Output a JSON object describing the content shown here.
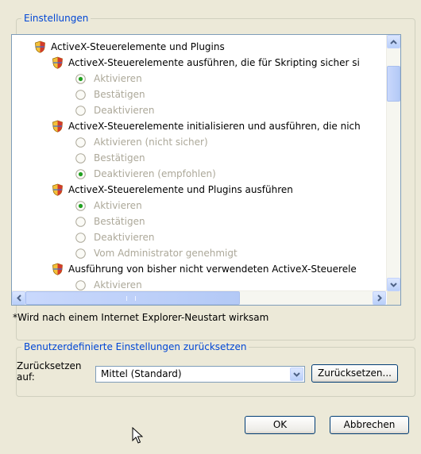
{
  "settings_group": {
    "title": "Einstellungen",
    "items": [
      {
        "kind": "category",
        "label": "ActiveX-Steuerelemente und Plugins"
      },
      {
        "kind": "setting",
        "label": "ActiveX-Steuerelemente ausführen, die für Skripting sicher si"
      },
      {
        "kind": "option",
        "label": "Aktivieren",
        "selected": true
      },
      {
        "kind": "option",
        "label": "Bestätigen",
        "selected": false
      },
      {
        "kind": "option",
        "label": "Deaktivieren",
        "selected": false
      },
      {
        "kind": "setting",
        "label": "ActiveX-Steuerelemente initialisieren und ausführen, die nich"
      },
      {
        "kind": "option",
        "label": "Aktivieren (nicht sicher)",
        "selected": false
      },
      {
        "kind": "option",
        "label": "Bestätigen",
        "selected": false
      },
      {
        "kind": "option",
        "label": "Deaktivieren (empfohlen)",
        "selected": true
      },
      {
        "kind": "setting",
        "label": "ActiveX-Steuerelemente und Plugins ausführen"
      },
      {
        "kind": "option",
        "label": "Aktivieren",
        "selected": true
      },
      {
        "kind": "option",
        "label": "Bestätigen",
        "selected": false
      },
      {
        "kind": "option",
        "label": "Deaktivieren",
        "selected": false
      },
      {
        "kind": "option",
        "label": "Vom Administrator genehmigt",
        "selected": false
      },
      {
        "kind": "setting",
        "label": "Ausführung von bisher nicht verwendeten ActiveX-Steuerele"
      },
      {
        "kind": "option",
        "label": "Aktivieren",
        "selected": false
      }
    ],
    "restart_note": "*Wird nach einem Internet Explorer-Neustart wirksam"
  },
  "reset_group": {
    "title": "Benutzerdefinierte Einstellungen zurücksetzen",
    "label_line1": "Zurücksetzen",
    "label_line2": "auf:",
    "level_value": "Mittel (Standard)",
    "reset_button": "Zurücksetzen..."
  },
  "buttons": {
    "ok": "OK",
    "cancel": "Abbrechen"
  },
  "icons": {
    "setting": "shield-icon",
    "radio": "radio-icon",
    "scroll_up": "scroll-up-arrow-icon",
    "scroll_down": "scroll-down-arrow-icon",
    "scroll_left": "scroll-left-arrow-icon",
    "scroll_right": "scroll-right-arrow-icon",
    "dropdown": "chevron-down-icon",
    "cursor": "mouse-pointer-icon"
  },
  "colors": {
    "accent": "#0046d5",
    "disabled_text": "#aca899",
    "radio_dot": "#21a121",
    "dialog_bg": "#ece9d8"
  }
}
